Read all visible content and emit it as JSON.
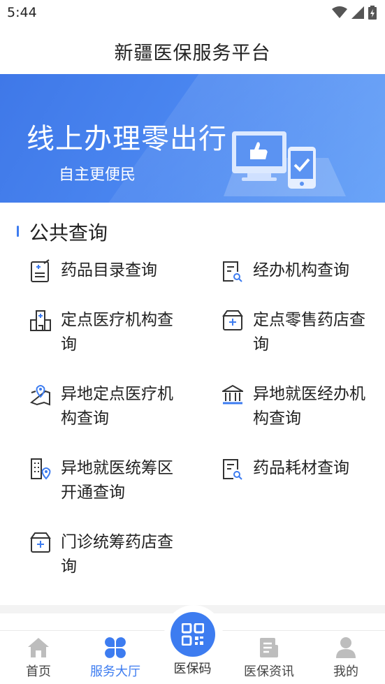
{
  "status_bar": {
    "time": "5:44"
  },
  "header": {
    "title": "新疆医保服务平台"
  },
  "banner": {
    "title": "线上办理零出行",
    "subtitle": "自主更便民"
  },
  "section": {
    "title": "公共查询",
    "items": [
      {
        "label": "药品目录查询",
        "icon": "drug-list-icon"
      },
      {
        "label": "经办机构查询",
        "icon": "document-search-icon"
      },
      {
        "label": "定点医疗机构查询",
        "icon": "hospital-building-icon"
      },
      {
        "label": "定点零售药店查询",
        "icon": "medical-kit-icon"
      },
      {
        "label": "异地定点医疗机构查询",
        "icon": "location-map-icon"
      },
      {
        "label": "异地就医经办机构查询",
        "icon": "institution-building-icon"
      },
      {
        "label": "异地就医统筹区开通查询",
        "icon": "city-location-icon"
      },
      {
        "label": "药品耗材查询",
        "icon": "document-search-icon"
      },
      {
        "label": "门诊统筹药店查询",
        "icon": "medical-kit-icon"
      }
    ]
  },
  "bottom_nav": {
    "items": [
      {
        "label": "首页",
        "icon": "home-icon"
      },
      {
        "label": "服务大厅",
        "icon": "clover-grid-icon"
      },
      {
        "label": "医保码",
        "icon": "qr-code-icon"
      },
      {
        "label": "医保资讯",
        "icon": "news-icon"
      },
      {
        "label": "我的",
        "icon": "user-icon"
      }
    ],
    "active_index": 1
  },
  "colors": {
    "accent": "#3d7cf0",
    "banner_start": "#3f78e8",
    "banner_end": "#6aa4f8"
  }
}
